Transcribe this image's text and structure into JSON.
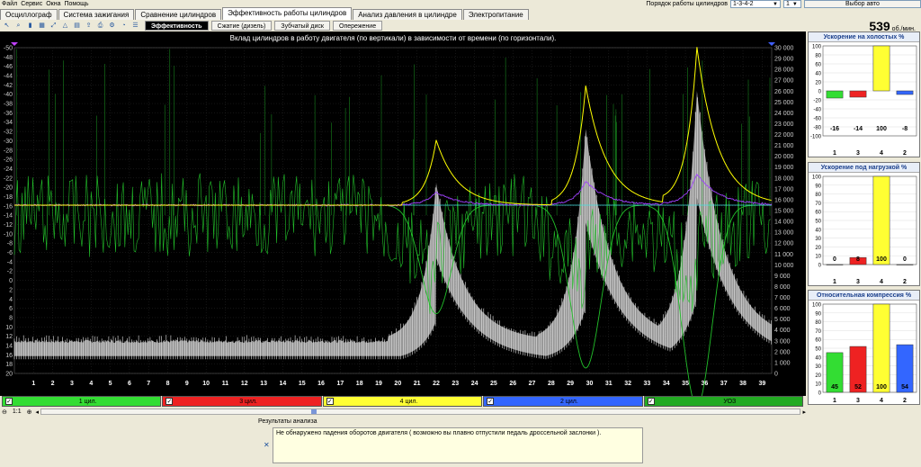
{
  "menu": [
    "Файл",
    "Сервис",
    "Окна",
    "Помощь"
  ],
  "top_controls": {
    "firing_order_label": "Порядок работы цилиндров",
    "firing_order_value": "1-3-4-2",
    "cylinder_value": "1",
    "auto_select": "Выбор авто"
  },
  "tabs": [
    "Осциллограф",
    "Система зажигания",
    "Сравнение цилиндров",
    "Эффективность работы цилиндров",
    "Анализ давления в цилиндре",
    "Электропитание"
  ],
  "active_tab": 3,
  "toolbar": {
    "icons": [
      "cursor-icon",
      "zoom-icon",
      "hold-icon",
      "grid-icon",
      "fit-icon",
      "measure-icon",
      "table-icon",
      "export-icon",
      "print-icon",
      "settings-icon",
      "chart-icon",
      "list-icon"
    ],
    "subtabs": [
      "Эффективность",
      "Сжатие (дизель)",
      "Зубчатый диск",
      "Опережение"
    ],
    "active_subtab": 0
  },
  "rpm": {
    "value": "539",
    "unit": "об./мин."
  },
  "chart_data": {
    "type": "line",
    "title": "Вклад цилиндров в работу двигателя (по вертикали) в зависимости от времени (по горизонтали).",
    "x_ticks": [
      1,
      2,
      3,
      4,
      5,
      6,
      7,
      8,
      9,
      10,
      11,
      12,
      13,
      14,
      15,
      16,
      17,
      18,
      19,
      20,
      21,
      22,
      23,
      24,
      25,
      26,
      27,
      28,
      29,
      30,
      31,
      32,
      33,
      34,
      35,
      36,
      37,
      38,
      39
    ],
    "y_left_ticks": [
      "-50",
      "-48",
      "-46",
      "-44",
      "-42",
      "-40",
      "-38",
      "-36",
      "-34",
      "-32",
      "-30",
      "-28",
      "-26",
      "-24",
      "-22",
      "-20",
      "-18",
      "-16",
      "-14",
      "-12",
      "-10",
      "-8",
      "-6",
      "-4",
      "-2",
      "0",
      "2",
      "4",
      "6",
      "8",
      "10",
      "12",
      "14",
      "16",
      "18",
      "20"
    ],
    "y_right_ticks": [
      "30 000",
      "29 000",
      "28 000",
      "27 000",
      "26 000",
      "25 000",
      "24 000",
      "23 000",
      "22 000",
      "21 000",
      "20 000",
      "19 000",
      "18 000",
      "17 000",
      "16 000",
      "15 000",
      "14 000",
      "13 000",
      "12 000",
      "11 000",
      "10 000",
      "9 000",
      "8 000",
      "7 000",
      "6 000",
      "5 000",
      "4 000",
      "3 000",
      "2 000",
      "1 000",
      "0"
    ],
    "ylim_left": [
      -50,
      20
    ],
    "ylim_right": [
      0,
      30000
    ],
    "xlim": [
      0,
      39.5
    ],
    "peaks_x": [
      22.0,
      29.8,
      35.6
    ],
    "yellow_peak_values": [
      21500,
      26500,
      30000
    ],
    "baseline_value": 15500,
    "colors": {
      "yellow": "#ffff00",
      "purple": "#a040ff",
      "green": "#22c02a",
      "gray": "#c8c8c8",
      "cyan": "#40e0e0"
    }
  },
  "cylinders": [
    {
      "label": "1 цил.",
      "color": "#33dd33",
      "checked": true
    },
    {
      "label": "3 цил.",
      "color": "#ee2222",
      "checked": true
    },
    {
      "label": "4 цил.",
      "color": "#ffff33",
      "checked": true
    },
    {
      "label": "2 цил.",
      "color": "#3366ff",
      "checked": true
    },
    {
      "label": "УОЗ",
      "color": "#22aa22",
      "checked": true
    }
  ],
  "zoom_label": "1:1",
  "results": {
    "header": "Результаты анализа",
    "text": "Не обнаружено падения оборотов двигателя ( возможно вы плавно отпустили педаль дроссельной заслонки )."
  },
  "panels": [
    {
      "title": "Ускорение на холостых %",
      "yticks": [
        "100",
        "80",
        "60",
        "40",
        "20",
        "0",
        "-20",
        "-40",
        "-60",
        "-80",
        "-100"
      ],
      "ylim": [
        -100,
        100
      ],
      "cyl_labels": [
        "1",
        "3",
        "4",
        "2"
      ],
      "values": [
        -16,
        -14,
        100,
        -8
      ],
      "value_labels": [
        "-16",
        "-14",
        "100",
        "-8"
      ],
      "colors": [
        "#33dd33",
        "#ee2222",
        "#ffff33",
        "#3366ff"
      ]
    },
    {
      "title": "Ускорение под нагрузкой %",
      "yticks": [
        "100",
        "90",
        "80",
        "70",
        "60",
        "50",
        "40",
        "30",
        "20",
        "10",
        "0"
      ],
      "ylim": [
        0,
        100
      ],
      "cyl_labels": [
        "1",
        "3",
        "4",
        "2"
      ],
      "values": [
        0,
        8,
        100,
        0
      ],
      "value_labels": [
        "0",
        "8",
        "100",
        "0"
      ],
      "colors": [
        "#33dd33",
        "#ee2222",
        "#ffff33",
        "#3366ff"
      ]
    },
    {
      "title": "Относительная компрессия %",
      "yticks": [
        "100",
        "90",
        "80",
        "70",
        "60",
        "50",
        "40",
        "30",
        "20",
        "10",
        "0"
      ],
      "ylim": [
        0,
        100
      ],
      "cyl_labels": [
        "1",
        "3",
        "4",
        "2"
      ],
      "values": [
        45,
        52,
        100,
        54
      ],
      "value_labels": [
        "45",
        "52",
        "100",
        "54"
      ],
      "colors": [
        "#33dd33",
        "#ee2222",
        "#ffff33",
        "#3366ff"
      ]
    }
  ]
}
